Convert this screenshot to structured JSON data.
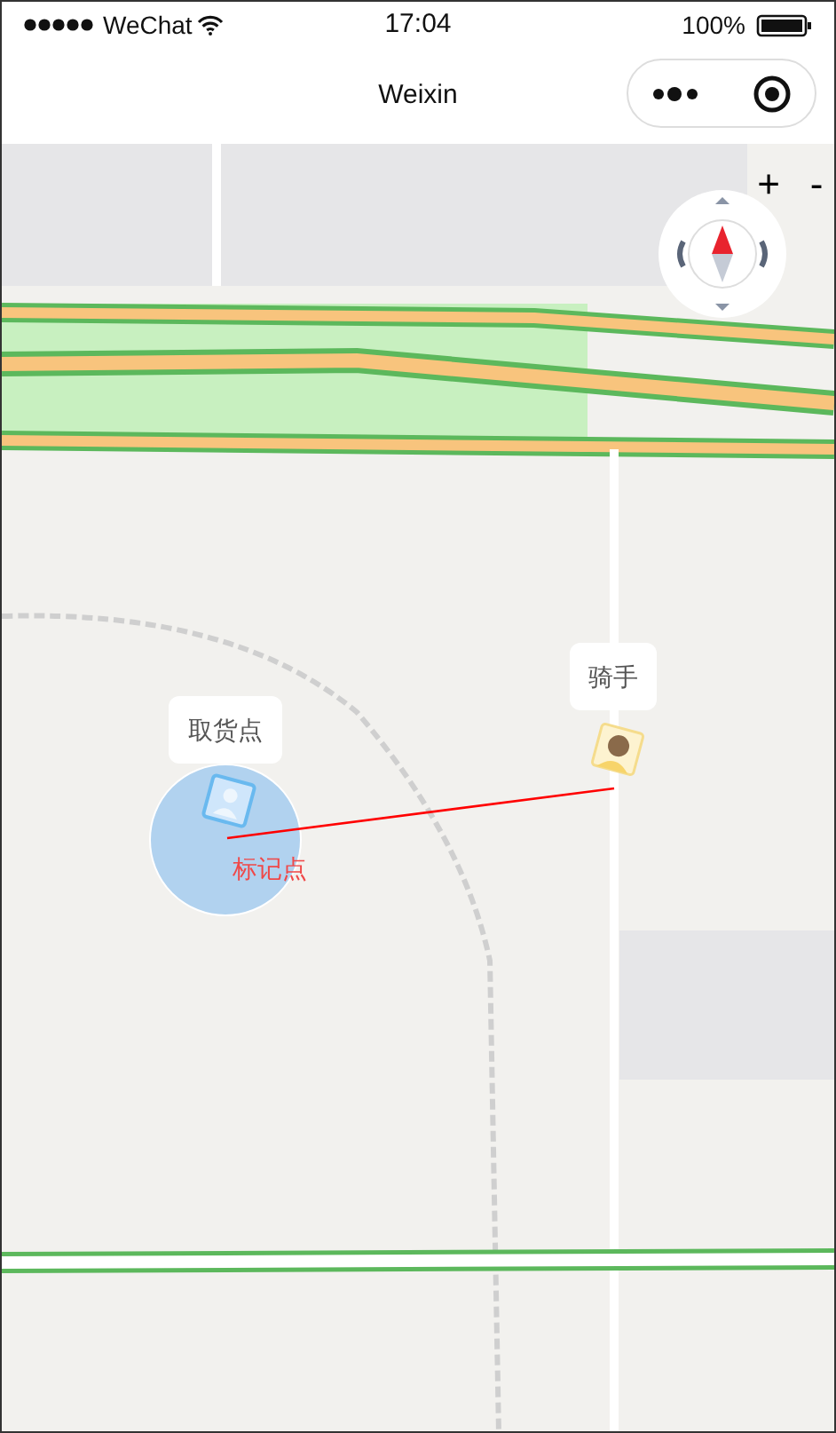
{
  "status_bar": {
    "carrier": "WeChat",
    "time": "17:04",
    "battery": "100%"
  },
  "nav_bar": {
    "title": "Weixin"
  },
  "map": {
    "kind": "picture",
    "zoom_controls": [
      "+",
      "-"
    ],
    "markers": [
      {
        "kind": "pickup",
        "label": "取货点"
      },
      {
        "kind": "rider",
        "label": "骑手"
      }
    ],
    "mark_label": "标记点"
  }
}
